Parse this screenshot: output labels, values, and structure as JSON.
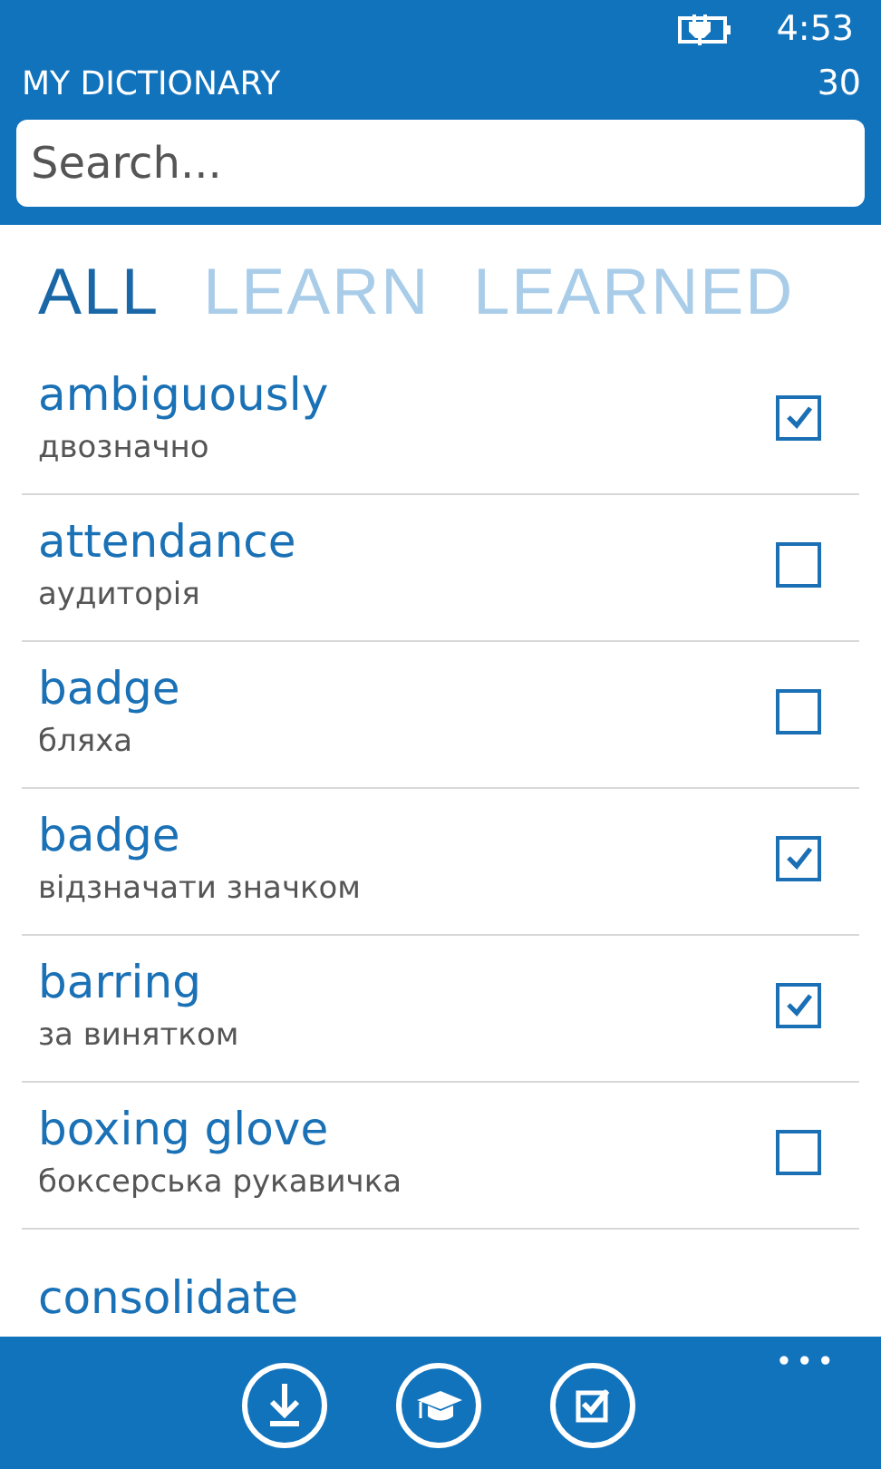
{
  "status_bar": {
    "time": "4:53"
  },
  "header": {
    "title": "MY DICTIONARY",
    "count": "30"
  },
  "search": {
    "placeholder": "Search..."
  },
  "tabs": [
    {
      "label": "ALL",
      "selected": true
    },
    {
      "label": "LEARN",
      "selected": false
    },
    {
      "label": "LEARNED",
      "selected": false
    }
  ],
  "words": [
    {
      "word": "ambiguously",
      "translation": "двозначно",
      "checked": true
    },
    {
      "word": "attendance",
      "translation": "аудиторія",
      "checked": false
    },
    {
      "word": "badge",
      "translation": "бляха",
      "checked": false
    },
    {
      "word": "badge",
      "translation": "відзначати значком",
      "checked": true
    },
    {
      "word": "barring",
      "translation": "за винятком",
      "checked": true
    },
    {
      "word": "boxing glove",
      "translation": "боксерська рукавичка",
      "checked": false
    },
    {
      "word": "consolidate"
    }
  ],
  "app_bar": {
    "buttons": [
      {
        "kind": "download"
      },
      {
        "kind": "learn"
      },
      {
        "kind": "check"
      }
    ],
    "more": "•••"
  }
}
